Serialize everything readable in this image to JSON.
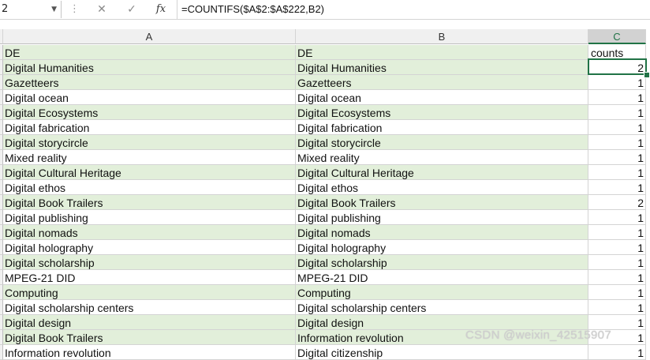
{
  "formula_bar": {
    "name_box": "2",
    "cancel_icon": "x-icon",
    "enter_icon": "check-icon",
    "fx_label": "fx",
    "formula": "=COUNTIFS($A$2:$A$222,B2)"
  },
  "columns": [
    {
      "letter": "A",
      "selected": false
    },
    {
      "letter": "B",
      "selected": false
    },
    {
      "letter": "C",
      "selected": true
    }
  ],
  "rows": [
    {
      "a": "DE",
      "b": "DE",
      "c": "counts",
      "shade": "green"
    },
    {
      "a": "Digital Humanities",
      "b": "Digital Humanities",
      "c": "2",
      "shade": "green"
    },
    {
      "a": "Gazetteers",
      "b": "Gazetteers",
      "c": "1",
      "shade": "green"
    },
    {
      "a": "Digital ocean",
      "b": "Digital ocean",
      "c": "1",
      "shade": "white"
    },
    {
      "a": "Digital Ecosystems",
      "b": "Digital Ecosystems",
      "c": "1",
      "shade": "green"
    },
    {
      "a": "Digital fabrication",
      "b": "Digital fabrication",
      "c": "1",
      "shade": "white"
    },
    {
      "a": "Digital storycircle",
      "b": "Digital storycircle",
      "c": "1",
      "shade": "green"
    },
    {
      "a": "Mixed reality",
      "b": "Mixed reality",
      "c": "1",
      "shade": "white"
    },
    {
      "a": "Digital Cultural Heritage",
      "b": "Digital Cultural Heritage",
      "c": "1",
      "shade": "green"
    },
    {
      "a": "Digital ethos",
      "b": "Digital ethos",
      "c": "1",
      "shade": "white"
    },
    {
      "a": "Digital Book Trailers",
      "b": "Digital Book Trailers",
      "c": "2",
      "shade": "green"
    },
    {
      "a": "Digital publishing",
      "b": "Digital publishing",
      "c": "1",
      "shade": "white"
    },
    {
      "a": "Digital nomads",
      "b": "Digital nomads",
      "c": "1",
      "shade": "green"
    },
    {
      "a": "Digital holography",
      "b": "Digital holography",
      "c": "1",
      "shade": "white"
    },
    {
      "a": "Digital scholarship",
      "b": "Digital scholarship",
      "c": "1",
      "shade": "green"
    },
    {
      "a": "MPEG-21 DID",
      "b": "MPEG-21 DID",
      "c": "1",
      "shade": "white"
    },
    {
      "a": "Computing",
      "b": "Computing",
      "c": "1",
      "shade": "green"
    },
    {
      "a": "Digital scholarship centers",
      "b": "Digital scholarship centers",
      "c": "1",
      "shade": "white"
    },
    {
      "a": "Digital design",
      "b": "Digital design",
      "c": "1",
      "shade": "green"
    },
    {
      "a": "Digital Book Trailers",
      "b": "Information revolution",
      "c": "1",
      "shade": "green"
    },
    {
      "a": "Information revolution",
      "b": "Digital citizenship",
      "c": "1",
      "shade": "white"
    }
  ],
  "watermark": "CSDN @weixin_42515907",
  "colors": {
    "band": "#e2efda",
    "accent": "#217346",
    "header": "#f0f0f0"
  }
}
